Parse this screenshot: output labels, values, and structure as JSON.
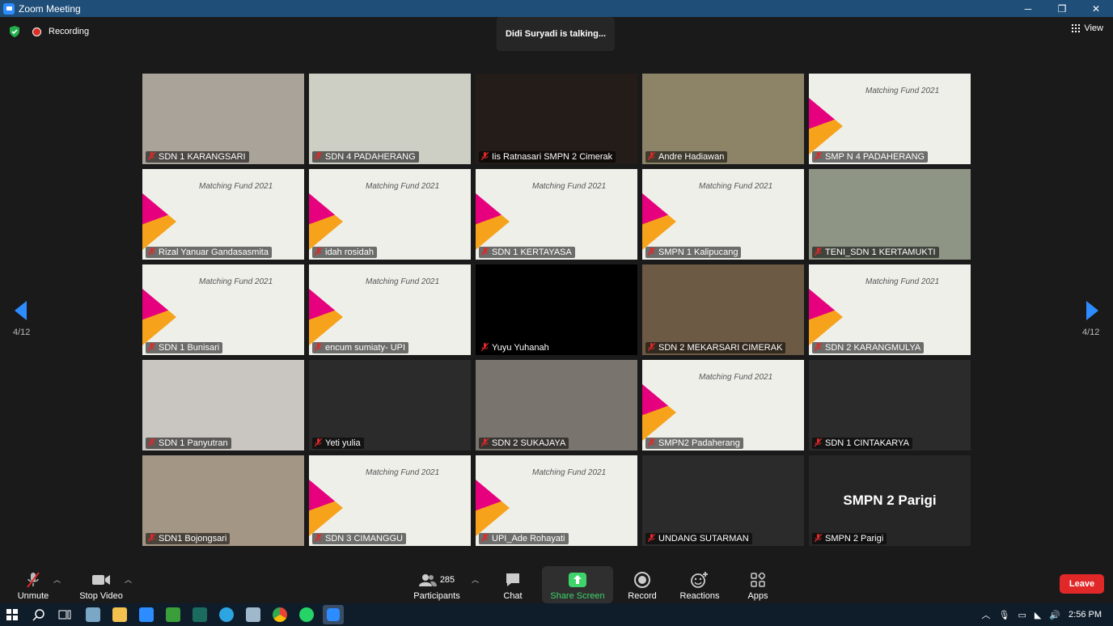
{
  "window": {
    "title": "Zoom Meeting",
    "controls": [
      "─",
      "❐",
      "✕"
    ]
  },
  "topbar": {
    "recording_label": "Recording",
    "talking_text": "Didi Suryadi is talking...",
    "view_label": "View"
  },
  "gallery": {
    "page_left": "4/12",
    "page_right": "4/12",
    "tiles": [
      {
        "name": "SDN 1 KARANGSARI",
        "kind": "camera",
        "bg": "#a9a39a"
      },
      {
        "name": "SDN 4 PADAHERANG",
        "kind": "camera",
        "bg": "#cdcfc4"
      },
      {
        "name": "Iis Ratnasari SMPN 2 Cimerak",
        "kind": "camera",
        "bg": "#241c18"
      },
      {
        "name": "Andre Hadiawan",
        "kind": "camera",
        "bg": "#8d8468"
      },
      {
        "name": "SMP N 4 PADAHERANG",
        "kind": "slide",
        "bg": "#efefea"
      },
      {
        "name": "Rizal Yanuar Gandasasmita",
        "kind": "slide",
        "bg": "#efefea"
      },
      {
        "name": "idah rosidah",
        "kind": "slide",
        "bg": "#efefea"
      },
      {
        "name": "SDN 1 KERTAYASA",
        "kind": "slide",
        "bg": "#efefea"
      },
      {
        "name": "SMPN 1 Kalipucang",
        "kind": "slide",
        "bg": "#efefea"
      },
      {
        "name": "TENI_SDN 1 KERTAMUKTI",
        "kind": "camera",
        "bg": "#8f9585"
      },
      {
        "name": "SDN 1 Bunisari",
        "kind": "slide",
        "bg": "#efefea"
      },
      {
        "name": "encum sumiaty- UPI",
        "kind": "slide",
        "bg": "#efefea"
      },
      {
        "name": "Yuyu Yuhanah",
        "kind": "camera",
        "bg": "#000000"
      },
      {
        "name": "SDN 2 MEKARSARI CIMERAK",
        "kind": "camera",
        "bg": "#6d5a44"
      },
      {
        "name": "SDN 2 KARANGMULYA",
        "kind": "slide",
        "bg": "#efefea"
      },
      {
        "name": "SDN 1 Panyutran",
        "kind": "camera",
        "bg": "#c9c6c2"
      },
      {
        "name": "Yeti yulia",
        "kind": "camera",
        "bg": "#2b2b2b"
      },
      {
        "name": "SDN 2 SUKAJAYA",
        "kind": "camera",
        "bg": "#7a746e"
      },
      {
        "name": "SMPN2 Padaherang",
        "kind": "slide",
        "bg": "#efefea"
      },
      {
        "name": "SDN 1 CINTAKARYA",
        "kind": "camera",
        "bg": "#2b2b2b"
      },
      {
        "name": "SDN1 Bojongsari",
        "kind": "camera",
        "bg": "#a49684"
      },
      {
        "name": "SDN 3 CIMANGGU",
        "kind": "slide",
        "bg": "#efefea"
      },
      {
        "name": "UPI_Ade Rohayati",
        "kind": "slide",
        "bg": "#efefea"
      },
      {
        "name": "UNDANG SUTARMAN",
        "kind": "camera",
        "bg": "#2b2b2b"
      },
      {
        "name": "SMPN 2 Parigi",
        "kind": "name-only",
        "bg": "#262626",
        "big_name": "SMPN 2 Parigi"
      }
    ],
    "slide_title": "Matching Fund 2021"
  },
  "toolbar": {
    "unmute": "Unmute",
    "stop_video": "Stop Video",
    "participants": "Participants",
    "participants_count": "285",
    "chat": "Chat",
    "share_screen": "Share Screen",
    "record": "Record",
    "reactions": "Reactions",
    "apps": "Apps",
    "leave": "Leave"
  },
  "taskbar": {
    "time": "2:56 PM"
  },
  "colors": {
    "accent": "#2d8cff",
    "leave": "#e02828",
    "share": "#3fd46b",
    "titlebar": "#1f4e79"
  }
}
